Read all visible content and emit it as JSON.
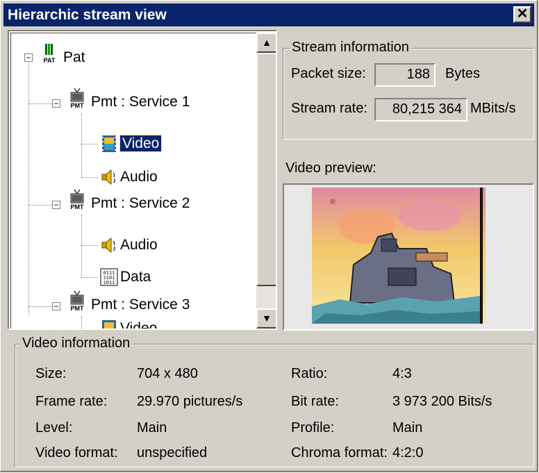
{
  "window": {
    "title": "Hierarchic stream view",
    "close_label": "✕"
  },
  "tree": {
    "nodes": [
      {
        "label": "Pat",
        "icon": "pat-icon"
      },
      {
        "label": "Pmt : Service 1",
        "icon": "pmt-tv-icon"
      },
      {
        "label": "Video",
        "icon": "video-film-icon"
      },
      {
        "label": "Audio",
        "icon": "speaker-icon"
      },
      {
        "label": "Pmt : Service 2",
        "icon": "pmt-tv-icon"
      },
      {
        "label": "Audio",
        "icon": "speaker-icon"
      },
      {
        "label": "Data",
        "icon": "binary-data-icon"
      },
      {
        "label": "Pmt : Service 3",
        "icon": "pmt-tv-icon"
      },
      {
        "label": "Video",
        "icon": "video-film-icon"
      }
    ],
    "icon_badges": {
      "pat": "PAT",
      "pmt": "PMT",
      "data_lines": [
        "0111",
        "1101",
        "1011"
      ]
    },
    "expander_symbol": "−",
    "scroll_up_symbol": "▲",
    "scroll_down_symbol": "▼"
  },
  "stream_info": {
    "legend": "Stream information",
    "packet_size_label": "Packet size:",
    "packet_size_value": "188",
    "packet_size_unit": "Bytes",
    "stream_rate_label": "Stream rate:",
    "stream_rate_value": "80,215 364",
    "stream_rate_unit": "MBits/s"
  },
  "video_preview": {
    "label": "Video preview:"
  },
  "video_info": {
    "legend": "Video information",
    "rows": [
      {
        "l1": "Size:",
        "v1": "704 x 480",
        "l2": "Ratio:",
        "v2": "4:3"
      },
      {
        "l1": "Frame rate:",
        "v1": "29.970 pictures/s",
        "l2": "Bit rate:",
        "v2": "3 973 200 Bits/s"
      },
      {
        "l1": "Level:",
        "v1": "Main",
        "l2": "Profile:",
        "v2": "Main"
      },
      {
        "l1": "Video format:",
        "v1": "unspecified",
        "l2": "Chroma format:",
        "v2": "4:2:0"
      }
    ]
  },
  "colors": {
    "title_bar": "#0a246a",
    "face": "#d4d0c8",
    "selection": "#0a246a"
  }
}
